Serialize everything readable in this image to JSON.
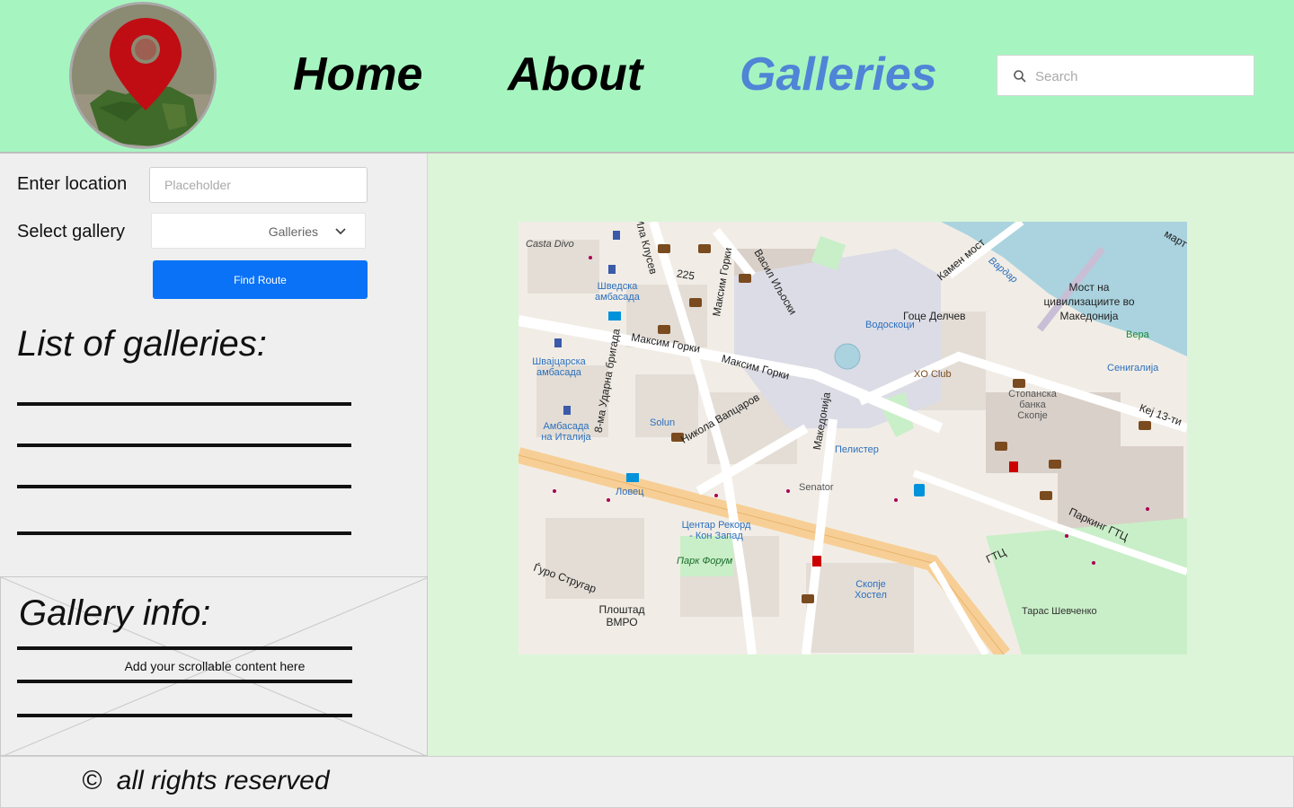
{
  "header": {
    "nav": [
      {
        "label": "Home"
      },
      {
        "label": "About"
      },
      {
        "label": "Galleries"
      }
    ],
    "search": {
      "placeholder": "Search"
    },
    "active_color": "#4f84d6",
    "background": "#a6f5c0"
  },
  "sidebar": {
    "location_label": "Enter location",
    "location_placeholder": "Placeholder",
    "gallery_label": "Select gallery",
    "gallery_value": "Galleries",
    "find_button": "Find Route",
    "list_title": "List of galleries:",
    "info_title": "Gallery info:",
    "info_text": "Add your scrollable content here"
  },
  "map": {
    "labels": {
      "casta_divo": "Casta Divo",
      "swedish_embassy": "Шведска амбасада",
      "swiss_embassy": "Швајцарска амбасада",
      "italy_embassy": "Амбасада на Италија",
      "goce": "Гоце Делчев",
      "vodoskoci": "Водоскоци",
      "xo_club": "XO Club",
      "stopanska": "Стопанска банка Скопје",
      "bridge": "Мост на цивилизациите во Македонија",
      "vera": "Вера",
      "senigalija": "Сенигалија",
      "solun": "Solun",
      "lovec": "Ловец",
      "pelister": "Пелистер",
      "senator": "Senator",
      "centar": "Центар Рекорд - Кон Запад",
      "park_forum": "Парк Форум",
      "ploshtad": "Плоштад ВМРО",
      "skopje_hostel": "Скопје Хостел",
      "taras": "Тарас Шевченко",
      "gtc": "ГТЦ",
      "parking_gtc": "Паркинг ГТЦ"
    },
    "streets": {
      "maksim1": "Максим Горки",
      "maksim2": "Максим Горки",
      "nikola": "Никола Вапцаров",
      "makedonija": "Македонија",
      "udarna": "8-ма Ударна бригада",
      "vasil": "Васил Иљоски",
      "kamen": "Камен мост",
      "djuro": "Ѓуро Стругар",
      "kej": "Кеј 13-ти",
      "vardar": "Вардар",
      "march": "март",
      "maksim_v": "Максим Горки",
      "klusev": "Ила Клусев",
      "n225": "225"
    }
  },
  "footer": {
    "copyright_symbol": "©",
    "text": "all rights reserved"
  }
}
